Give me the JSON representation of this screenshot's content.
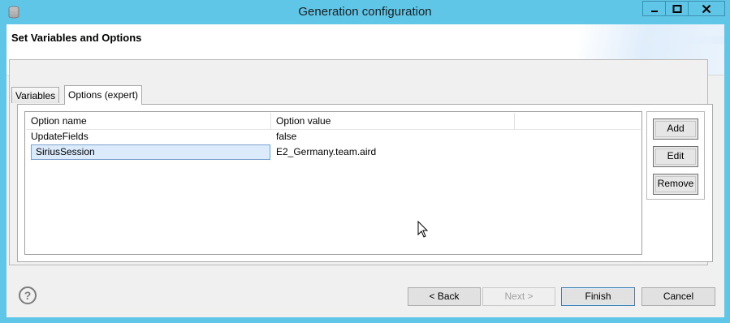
{
  "window": {
    "title": "Generation configuration",
    "app_icon": "stack-icon"
  },
  "header": {
    "title": "Set Variables and Options"
  },
  "tabs": [
    {
      "label": "Variables",
      "active": false
    },
    {
      "label": "Options (expert)",
      "active": true
    }
  ],
  "table": {
    "columns": [
      "Option name",
      "Option value",
      ""
    ],
    "rows": [
      {
        "name": "UpdateFields",
        "value": "false",
        "selected": false
      },
      {
        "name": "SiriusSession",
        "value": "E2_Germany.team.aird",
        "selected": true
      }
    ]
  },
  "side_buttons": {
    "add": "Add",
    "edit": "Edit",
    "remove": "Remove"
  },
  "footer": {
    "back": "< Back",
    "next": "Next >",
    "finish": "Finish",
    "cancel": "Cancel"
  },
  "colors": {
    "titlebar": "#5fc6e8",
    "selection": "#dcebfc"
  }
}
